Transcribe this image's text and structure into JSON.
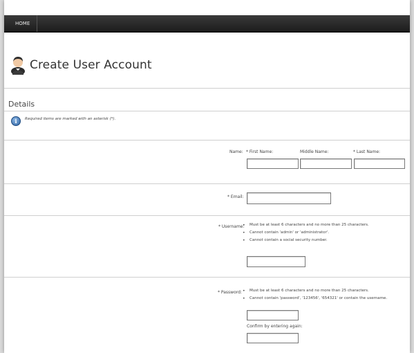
{
  "nav": {
    "home_label": "HOME"
  },
  "page": {
    "title": "Create User Account"
  },
  "details": {
    "section_title": "Details",
    "required_note": "Required items are marked with an asterisk (*)."
  },
  "name": {
    "label": "Name:",
    "first_label": "* First Name:",
    "middle_label": "Middle Name:",
    "last_label": "* Last Name:",
    "first_value": "",
    "middle_value": "",
    "last_value": ""
  },
  "email": {
    "label": "* Email:",
    "value": ""
  },
  "username": {
    "label": "* Username:",
    "rules": [
      "Must be at least 6 characters and no more than 25 characters.",
      "Cannot contain 'admin' or 'administrator'.",
      "Cannot contain a social security number."
    ],
    "value": ""
  },
  "password": {
    "label": "* Password:",
    "rules": [
      "Must be at least 6 characters and no more than 25 characters.",
      "Cannot contain 'password', '123456', '654321' or contain the username."
    ],
    "value": "",
    "confirm_label": "Confirm by entering again:",
    "confirm_value": ""
  }
}
